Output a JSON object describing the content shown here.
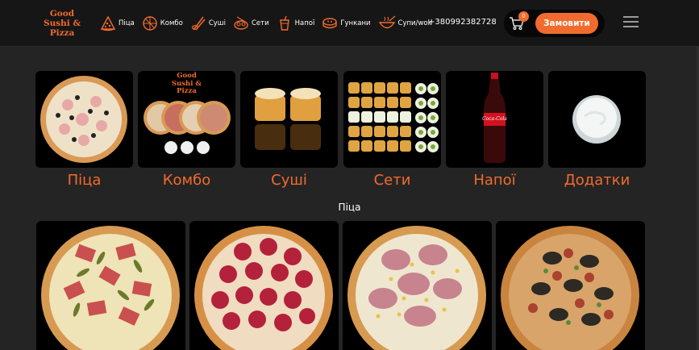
{
  "logo": {
    "line1": "Good",
    "line2": "Sushi &",
    "line3": "Pizza"
  },
  "nav": [
    {
      "label": "Піца",
      "icon": "pizza-slice-icon"
    },
    {
      "label": "Комбо",
      "icon": "pizza-icon"
    },
    {
      "label": "Суші",
      "icon": "chopsticks-icon"
    },
    {
      "label": "Сети",
      "icon": "sushi-set-icon"
    },
    {
      "label": "Напої",
      "icon": "drink-cup-icon"
    },
    {
      "label": "Гункани",
      "icon": "gunkan-icon"
    },
    {
      "label": "Супи/wok",
      "icon": "bowl-icon"
    }
  ],
  "phone": "+380992382728",
  "cart": {
    "count": "0",
    "icon": "cart-icon"
  },
  "order_label": "Замовити",
  "menu_icon": "hamburger-menu-icon",
  "categories": [
    {
      "label": "Піца"
    },
    {
      "label": "Комбо",
      "logo_line1": "Good",
      "logo_line2": "Sushi &",
      "logo_line3": "Pizza"
    },
    {
      "label": "Суші"
    },
    {
      "label": "Сети"
    },
    {
      "label": "Напої",
      "bottle_text": "Coca-Cola"
    },
    {
      "label": "Додатки"
    }
  ],
  "section_title": "Піца",
  "products": [
    {
      "name": "pizza-ham-pickles"
    },
    {
      "name": "pizza-pepperoni"
    },
    {
      "name": "pizza-ham-corn"
    },
    {
      "name": "pizza-meat-herbs"
    }
  ],
  "colors": {
    "accent": "#f26b2e",
    "header": "#161616",
    "background": "#242424"
  }
}
